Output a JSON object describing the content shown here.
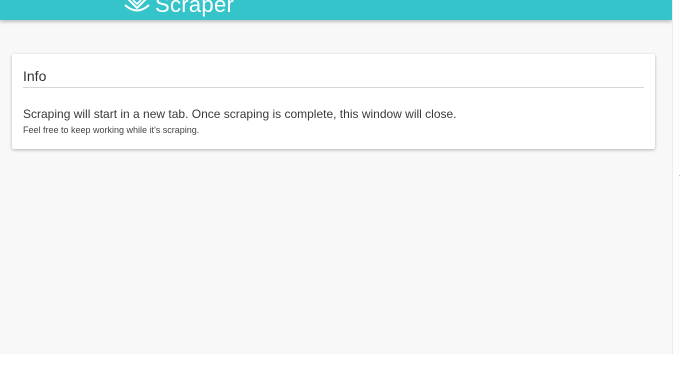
{
  "header": {
    "app_name": "Scraper",
    "logo_icon": "scraper-logo-icon",
    "background_color": "#35c4c9"
  },
  "info_card": {
    "title": "Info",
    "message": "Scraping will start in a new tab. Once scraping is complete, this window will close.",
    "note": "Feel free to keep working while it's scraping."
  }
}
